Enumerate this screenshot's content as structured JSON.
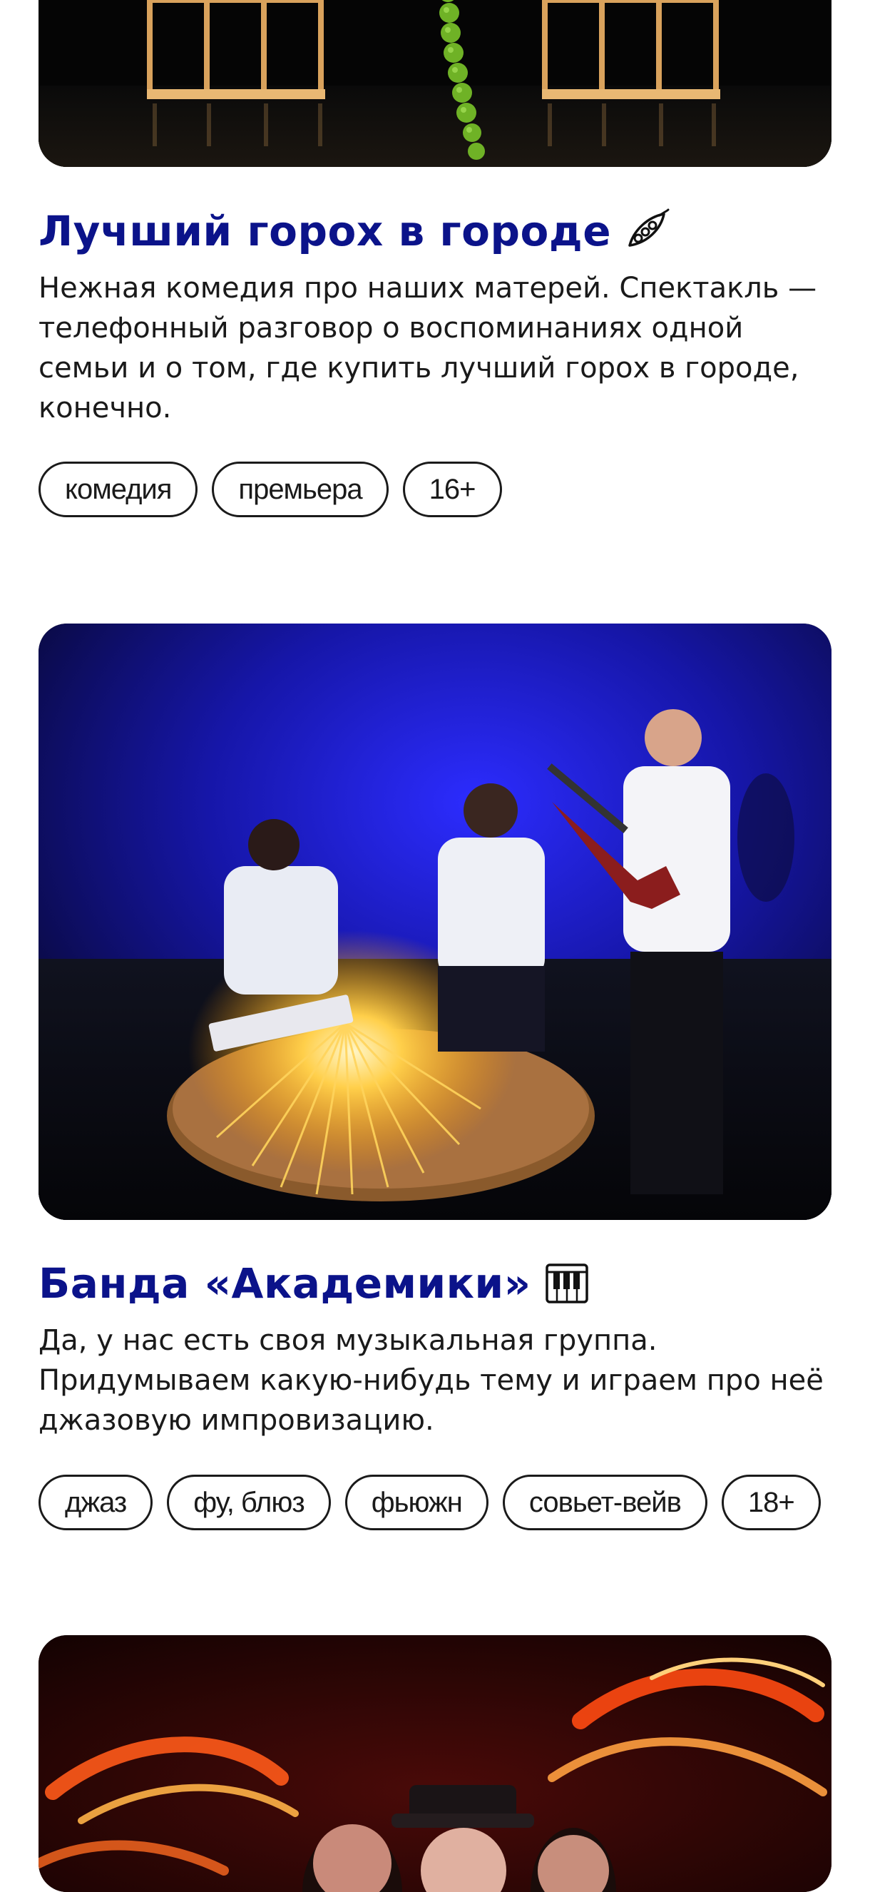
{
  "events": [
    {
      "title": "Лучший горох в городе",
      "emoji": "pea-pod-icon",
      "description": "Нежная комедия про наших матерей. Спектакль — телефонный разговор о воспоминаниях одной семьи и о том, где купить лучший горох в городе, конечно.",
      "tags": [
        "комедия",
        "премьера",
        "16+"
      ]
    },
    {
      "title": "Банда «Академики»",
      "emoji": "piano-keys-icon",
      "description": "Да, у нас есть своя музыкальная группа. Придумываем какую-нибудь тему и играем про неё джазовую импровизацию.",
      "tags": [
        "джаз",
        "фу, блюз",
        "фьюжн",
        "совьет-вейв",
        "18+"
      ]
    }
  ],
  "colors": {
    "title": "#0b138a",
    "text": "#1a1a1a",
    "background": "#ffffff"
  }
}
